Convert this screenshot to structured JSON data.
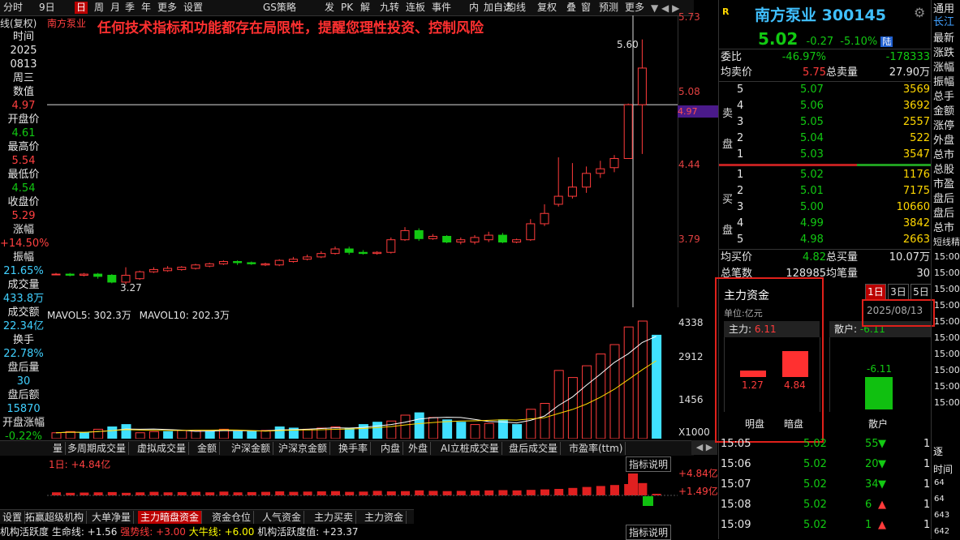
{
  "toolbar": {
    "items": [
      "分时",
      "9日",
      "日",
      "周",
      "月",
      "季",
      "年",
      "更多",
      "设置",
      "GS策略",
      "发",
      "PK",
      "解",
      "九转",
      "连板",
      "事件",
      "内",
      "加自选",
      "均线",
      "复权",
      "叠",
      "窗",
      "预测",
      "更多"
    ],
    "active": "日"
  },
  "stock_tag": "南方泵业",
  "chart_label": "线(复权)",
  "warning": "任何技术指标和功能都存在局限性，提醒您理性投资、控制风险",
  "left_info": [
    {
      "label": "时间",
      "value": ""
    },
    {
      "label": "2025",
      "value": ""
    },
    {
      "label": "0813",
      "value": ""
    },
    {
      "label": "周三",
      "value": ""
    },
    {
      "label": "数值",
      "value": "4.97"
    },
    {
      "label": "开盘价",
      "value": "4.61"
    },
    {
      "label": "最高价",
      "value": "5.54"
    },
    {
      "label": "最低价",
      "value": "4.54"
    },
    {
      "label": "收盘价",
      "value": "5.29"
    },
    {
      "label": "涨幅",
      "value": "+14.50%"
    },
    {
      "label": "振幅",
      "value": "21.65%"
    },
    {
      "label": "成交量",
      "value": "433.8万"
    },
    {
      "label": "成交额",
      "value": "22.34亿"
    },
    {
      "label": "换手",
      "value": "22.78%"
    },
    {
      "label": "盘后量",
      "value": "30"
    },
    {
      "label": "盘后额",
      "value": "15870"
    },
    {
      "label": "开盘涨幅",
      "value": "-0.22%"
    }
  ],
  "price_axis": [
    "5.73",
    "5.08",
    "4.44",
    "3.79"
  ],
  "crosshair_value": "4.97",
  "high_marker": "5.60",
  "low_marker": "3.27",
  "volume_axis": [
    "4338",
    "2912",
    "1456",
    "X1000"
  ],
  "volume_legend": {
    "mavol5": "MAVOL5: 302.3万",
    "mavol10": "MAVOL10: 202.3万"
  },
  "chart_data": {
    "type": "candlestick",
    "ylim": [
      3.2,
      5.75
    ],
    "candles": [
      {
        "o": 3.49,
        "c": 3.49,
        "h": 3.5,
        "l": 3.48
      },
      {
        "o": 3.49,
        "c": 3.48,
        "h": 3.5,
        "l": 3.47
      },
      {
        "o": 3.48,
        "c": 3.49,
        "h": 3.5,
        "l": 3.47
      },
      {
        "o": 3.49,
        "c": 3.47,
        "h": 3.5,
        "l": 3.45
      },
      {
        "o": 3.48,
        "c": 3.42,
        "h": 3.49,
        "l": 3.41
      },
      {
        "o": 3.42,
        "c": 3.48,
        "h": 3.55,
        "l": 3.4
      },
      {
        "o": 3.45,
        "c": 3.51,
        "h": 3.52,
        "l": 3.44
      },
      {
        "o": 3.51,
        "c": 3.53,
        "h": 3.55,
        "l": 3.5
      },
      {
        "o": 3.52,
        "c": 3.54,
        "h": 3.56,
        "l": 3.51
      },
      {
        "o": 3.53,
        "c": 3.55,
        "h": 3.56,
        "l": 3.52
      },
      {
        "o": 3.54,
        "c": 3.57,
        "h": 3.58,
        "l": 3.53
      },
      {
        "o": 3.56,
        "c": 3.58,
        "h": 3.59,
        "l": 3.55
      },
      {
        "o": 3.58,
        "c": 3.6,
        "h": 3.61,
        "l": 3.57
      },
      {
        "o": 3.6,
        "c": 3.59,
        "h": 3.61,
        "l": 3.57
      },
      {
        "o": 3.59,
        "c": 3.58,
        "h": 3.6,
        "l": 3.57
      },
      {
        "o": 3.57,
        "c": 3.58,
        "h": 3.59,
        "l": 3.56
      },
      {
        "o": 3.57,
        "c": 3.61,
        "h": 3.62,
        "l": 3.56
      },
      {
        "o": 3.6,
        "c": 3.62,
        "h": 3.64,
        "l": 3.59
      },
      {
        "o": 3.62,
        "c": 3.64,
        "h": 3.66,
        "l": 3.61
      },
      {
        "o": 3.64,
        "c": 3.67,
        "h": 3.69,
        "l": 3.63
      },
      {
        "o": 3.67,
        "c": 3.71,
        "h": 3.73,
        "l": 3.66
      },
      {
        "o": 3.71,
        "c": 3.68,
        "h": 3.73,
        "l": 3.66
      },
      {
        "o": 3.68,
        "c": 3.67,
        "h": 3.7,
        "l": 3.66
      },
      {
        "o": 3.67,
        "c": 3.68,
        "h": 3.69,
        "l": 3.66
      },
      {
        "o": 3.68,
        "c": 3.79,
        "h": 3.81,
        "l": 3.67
      },
      {
        "o": 3.79,
        "c": 3.87,
        "h": 3.9,
        "l": 3.78
      },
      {
        "o": 3.87,
        "c": 3.8,
        "h": 3.89,
        "l": 3.78
      },
      {
        "o": 3.8,
        "c": 3.82,
        "h": 3.84,
        "l": 3.79
      },
      {
        "o": 3.82,
        "c": 3.77,
        "h": 3.83,
        "l": 3.76
      },
      {
        "o": 3.77,
        "c": 3.79,
        "h": 3.81,
        "l": 3.75
      },
      {
        "o": 3.77,
        "c": 3.81,
        "h": 3.83,
        "l": 3.75
      },
      {
        "o": 3.79,
        "c": 3.83,
        "h": 3.86,
        "l": 3.77
      },
      {
        "o": 3.83,
        "c": 3.77,
        "h": 3.85,
        "l": 3.76
      },
      {
        "o": 3.77,
        "c": 3.79,
        "h": 3.8,
        "l": 3.76
      },
      {
        "o": 3.79,
        "c": 3.93,
        "h": 3.97,
        "l": 3.78
      },
      {
        "o": 3.93,
        "c": 4.02,
        "h": 4.1,
        "l": 3.91
      },
      {
        "o": 4.1,
        "c": 4.17,
        "h": 4.51,
        "l": 4.08
      },
      {
        "o": 4.17,
        "c": 4.25,
        "h": 4.46,
        "l": 4.15
      },
      {
        "o": 4.25,
        "c": 4.37,
        "h": 4.43,
        "l": 4.2
      },
      {
        "o": 4.37,
        "c": 4.41,
        "h": 4.48,
        "l": 4.33
      },
      {
        "o": 4.42,
        "c": 4.5,
        "h": 4.53,
        "l": 4.38
      },
      {
        "o": 4.5,
        "c": 4.97,
        "h": 4.98,
        "l": 4.5
      },
      {
        "o": 4.97,
        "c": 5.29,
        "h": 5.54,
        "l": 4.54
      }
    ],
    "volume": [
      0.05,
      0.06,
      0.05,
      0.08,
      0.1,
      0.12,
      0.05,
      0.06,
      0.06,
      0.07,
      0.07,
      0.06,
      0.08,
      0.06,
      0.06,
      0.07,
      0.1,
      0.09,
      0.08,
      0.09,
      0.1,
      0.09,
      0.12,
      0.14,
      0.15,
      0.2,
      0.22,
      0.18,
      0.16,
      0.14,
      0.12,
      0.13,
      0.16,
      0.12,
      0.25,
      0.3,
      0.58,
      0.52,
      0.62,
      0.72,
      0.8,
      0.95,
      1.0,
      0.88
    ],
    "volume_colors": [
      "r",
      "r",
      "g",
      "r",
      "g",
      "g",
      "r",
      "r",
      "g",
      "r",
      "r",
      "g",
      "r",
      "g",
      "g",
      "r",
      "g",
      "g",
      "r",
      "r",
      "r",
      "g",
      "g",
      "g",
      "r",
      "r",
      "g",
      "r",
      "g",
      "g",
      "r",
      "r",
      "g",
      "g",
      "r",
      "r",
      "r",
      "r",
      "r",
      "r",
      "r",
      "r",
      "r",
      "g"
    ]
  },
  "bottom_tabs": [
    "量",
    "多周期成交量",
    "虚拟成交量",
    "金额",
    "沪深金额",
    "沪深京金额",
    "换手率",
    "内盘",
    "外盘",
    "AI立桩成交量",
    "盘后成交量",
    "市盈率(ttm)"
  ],
  "indicator_label": "1日: +4.84亿",
  "indicator_axis": [
    "+4.84亿",
    "+1.49亿"
  ],
  "indicator_tabs": [
    "设置",
    "拓赢超级机构",
    "大单净量",
    "主力暗盘资金",
    "资金仓位",
    "人气资金",
    "主力买卖",
    "主力资金"
  ],
  "indicator_active": "主力暗盘资金",
  "indicator_note": "指标说明",
  "status_bar": {
    "a": "机构活跃度 生命线: +1.56",
    "b": "强势线: +3.00",
    "c": "大牛线: +6.00",
    "d": "机构活跃度值: +23.37"
  },
  "stock": {
    "name": "南方泵业",
    "code": "300145",
    "price": "5.02",
    "change": "-0.27",
    "pct": "-5.10%",
    "badge": "陆"
  },
  "weibi": {
    "label": "委比",
    "value": "-46.97%",
    "diff": "-178333"
  },
  "avg_sell": {
    "label": "均卖价",
    "value": "5.75",
    "label2": "总卖量",
    "value2": "27.90万"
  },
  "sells": [
    {
      "lvl": "5",
      "price": "5.07",
      "vol": "3569"
    },
    {
      "lvl": "4",
      "price": "5.06",
      "vol": "3692"
    },
    {
      "lvl": "3",
      "price": "5.05",
      "vol": "2557"
    },
    {
      "lvl": "2",
      "price": "5.04",
      "vol": "522"
    },
    {
      "lvl": "1",
      "price": "5.03",
      "vol": "3547"
    }
  ],
  "buys": [
    {
      "lvl": "1",
      "price": "5.02",
      "vol": "1176"
    },
    {
      "lvl": "2",
      "price": "5.01",
      "vol": "7175"
    },
    {
      "lvl": "3",
      "price": "5.00",
      "vol": "10660"
    },
    {
      "lvl": "4",
      "price": "4.99",
      "vol": "3842"
    },
    {
      "lvl": "5",
      "price": "4.98",
      "vol": "2663"
    }
  ],
  "sell_side_label": [
    "卖",
    "盘"
  ],
  "buy_side_label": [
    "买",
    "盘"
  ],
  "avg_buy": {
    "label": "均买价",
    "value": "4.82",
    "label2": "总买量",
    "value2": "10.07万"
  },
  "total_trades": {
    "label": "总笔数",
    "value": "128985",
    "label2": "均笔量",
    "value2": "30"
  },
  "capital": {
    "title": "主力资金",
    "unit": "单位:亿元",
    "periods": [
      "1日",
      "3日",
      "5日"
    ],
    "date": "2025/08/13",
    "main_label": "主力:",
    "main_value": "6.11",
    "retail_label": "散户:",
    "retail_value": "-6.11",
    "bar_mingpan": "1.27",
    "bar_anpan": "4.84",
    "bar_retail": "-6.11",
    "labels": [
      "明盘",
      "暗盘",
      "散户"
    ]
  },
  "ticks": [
    {
      "time": "15:05",
      "price": "5.02",
      "vol": "55",
      "dir": "down",
      "n": "1"
    },
    {
      "time": "15:06",
      "price": "5.02",
      "vol": "20",
      "dir": "down",
      "n": "1"
    },
    {
      "time": "15:07",
      "price": "5.02",
      "vol": "34",
      "dir": "down",
      "n": "1"
    },
    {
      "time": "15:08",
      "price": "5.02",
      "vol": "6",
      "dir": "up",
      "n": "1"
    },
    {
      "time": "15:09",
      "price": "5.02",
      "vol": "1",
      "dir": "up",
      "n": "1"
    }
  ],
  "far_right": {
    "top": "通用",
    "sub": "长江",
    "labels": [
      "最新",
      "涨跌",
      "涨幅",
      "振幅",
      "总手",
      "金额",
      "涨停",
      "外盘",
      "总市",
      "总股",
      "市盈",
      "盘后",
      "盘后",
      "总市"
    ],
    "tag": "短线精",
    "times": [
      "15:00",
      "15:00",
      "15:00",
      "15:00",
      "15:00",
      "15:00",
      "15:00",
      "15:00",
      "15:00",
      "15:00"
    ],
    "bottom_label": "逐",
    "bottom_head": "时间",
    "bottom_vals": [
      "64",
      "64",
      "643",
      "642"
    ]
  }
}
